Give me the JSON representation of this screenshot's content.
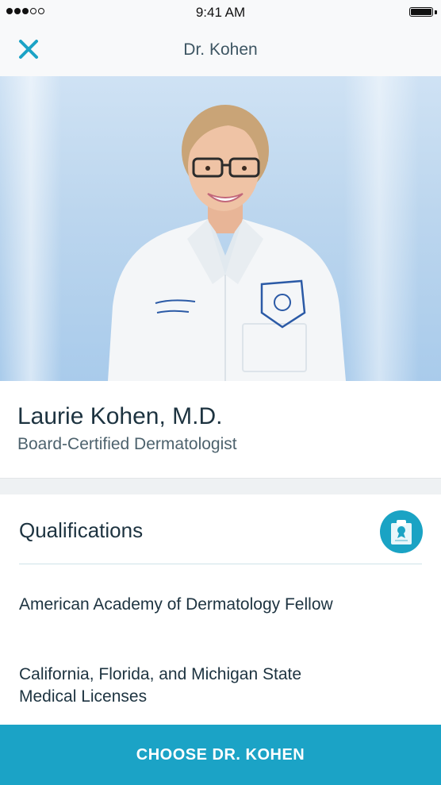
{
  "status_bar": {
    "time": "9:41 AM",
    "signal_bars_filled": 3,
    "signal_bars_total": 5,
    "battery_level": 1.0
  },
  "nav": {
    "title": "Dr. Kohen",
    "close_icon": "close-icon"
  },
  "doctor": {
    "name": "Laurie Kohen, M.D.",
    "specialty": "Board-Certified Dermatologist"
  },
  "qualifications": {
    "title": "Qualifications",
    "icon": "certificate-icon",
    "items": [
      "American Academy of Dermatology Fellow",
      "California, Florida, and Michigan State Medical Licenses"
    ]
  },
  "cta": {
    "label": "CHOOSE DR. KOHEN"
  },
  "colors": {
    "accent": "#1ba3c6",
    "text_dark": "#1d3340",
    "text_muted": "#4d626d"
  }
}
